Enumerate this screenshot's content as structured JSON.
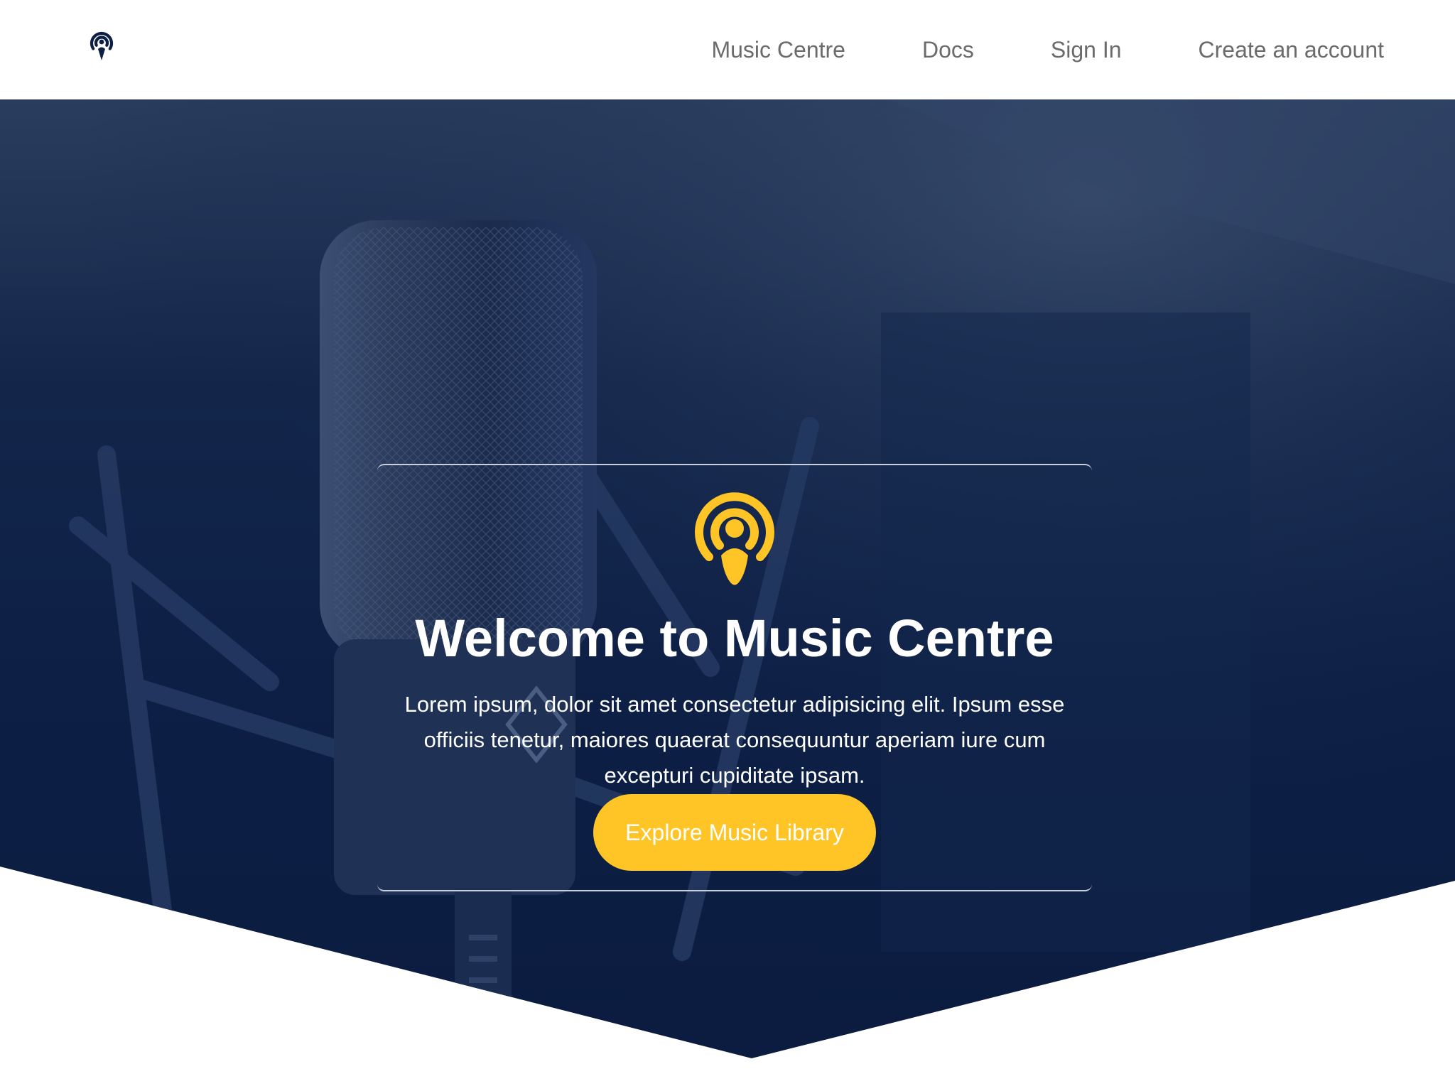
{
  "navbar": {
    "logo_icon": "podcast-icon",
    "links": [
      {
        "label": "Music Centre"
      },
      {
        "label": "Docs"
      },
      {
        "label": "Sign In"
      },
      {
        "label": "Create an account"
      }
    ]
  },
  "hero": {
    "background_image": "studio-microphone-photo",
    "icon": "podcast-icon",
    "title": "Welcome to Music Centre",
    "description": "Lorem ipsum, dolor sit amet consectetur adipisicing elit. Ipsum esse officiis tenetur, maiores quaerat consequuntur aperiam iure cum excepturi cupiditate ipsam.",
    "cta_label": "Explore Music Library"
  },
  "colors": {
    "accent": "#ffc527",
    "hero_background": "#0d1f45",
    "nav_text": "#6b6b6b",
    "logo": "#0d1f45"
  }
}
